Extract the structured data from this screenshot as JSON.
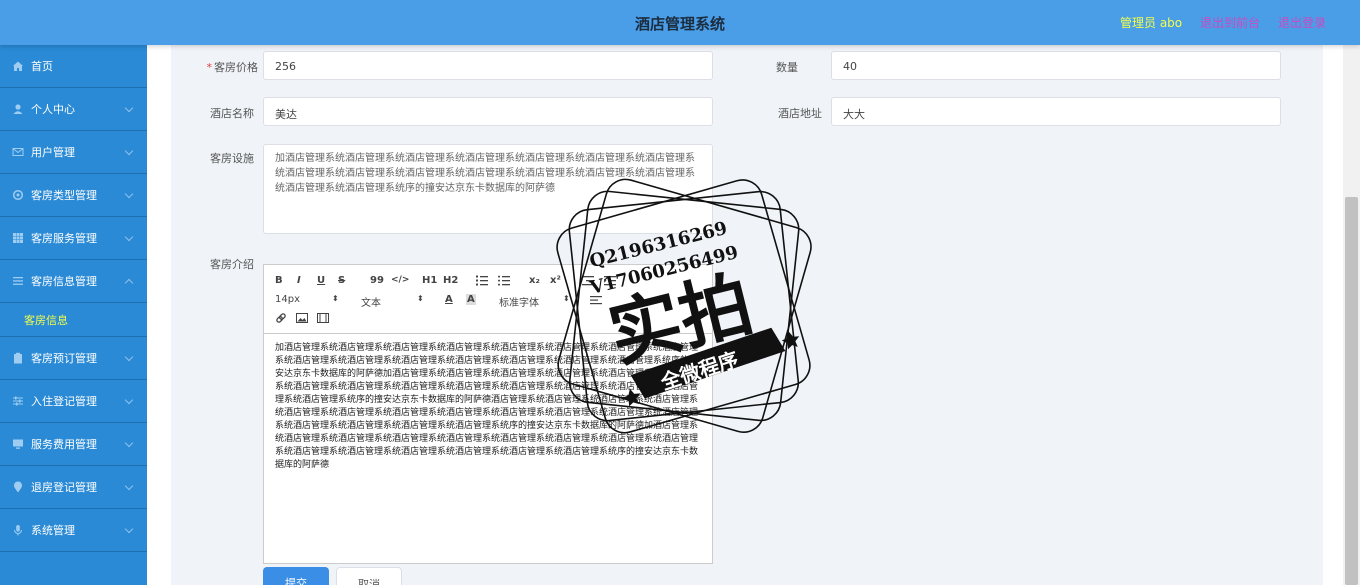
{
  "header": {
    "title": "酒店管理系统",
    "user": "管理员 abo",
    "to_front": "退出到前台",
    "logout": "退出登录"
  },
  "sidebar": {
    "items": [
      {
        "label": "首页",
        "icon": "home-icon"
      },
      {
        "label": "个人中心",
        "icon": "user-icon"
      },
      {
        "label": "用户管理",
        "icon": "mail-icon"
      },
      {
        "label": "客房类型管理",
        "icon": "gear-icon"
      },
      {
        "label": "客房服务管理",
        "icon": "grid-icon"
      },
      {
        "label": "客房信息管理",
        "icon": "list-icon"
      },
      {
        "label": "客房预订管理",
        "icon": "clipboard-icon"
      },
      {
        "label": "入住登记管理",
        "icon": "sliders-icon"
      },
      {
        "label": "服务费用管理",
        "icon": "monitor-icon"
      },
      {
        "label": "退房登记管理",
        "icon": "pin-icon"
      },
      {
        "label": "系统管理",
        "icon": "mic-icon"
      }
    ],
    "sub_item": "客房信息"
  },
  "form": {
    "price_label": "客房价格",
    "price_value": "256",
    "quantity_label": "数量",
    "quantity_value": "40",
    "hotel_name_label": "酒店名称",
    "hotel_name_value": "美达",
    "hotel_address_label": "酒店地址",
    "hotel_address_value": "大大",
    "facilities_label": "客房设施",
    "facilities_value": "加酒店管理系统酒店管理系统酒店管理系统酒店管理系统酒店管理系统酒店管理系统酒店管理系统酒店管理系统酒店管理系统酒店管理系统酒店管理系统酒店管理系统酒店管理系统酒店管理系统酒店管理系统酒店管理系统序的撞安达京东卡数据库的阿萨德",
    "intro_label": "客房介绍",
    "intro_value": "加酒店管理系统酒店管理系统酒店管理系统酒店管理系统酒店管理系统酒店管理系统酒店管理系统酒店管理系统酒店管理系统酒店管理系统酒店管理系统酒店管理系统酒店管理系统酒店管理系统酒店管理系统序的撞安达京东卡数据库的阿萨德加酒店管理系统酒店管理系统酒店管理系统酒店管理系统酒店管理系统酒店管理系统酒店管理系统酒店管理系统酒店管理系统酒店管理系统酒店管理系统酒店管理系统酒店管理系统酒店管理系统酒店管理系统序的撞安达京东卡数据库的阿萨德酒店管理系统酒店管理系统酒店管理系统酒店管理系统酒店管理系统酒店管理系统酒店管理系统酒店管理系统酒店管理系统酒店管理系统酒店管理系统酒店管理系统酒店管理系统酒店管理系统酒店管理系统酒店管理系统序的撞安达京东卡数据库的阿萨德加酒店管理系统酒店管理系统酒店管理系统酒店管理系统酒店管理系统酒店管理系统酒店管理系统酒店管理系统酒店管理系统酒店管理系统酒店管理系统酒店管理系统酒店管理系统酒店管理系统酒店管理系统序的撞安达京东卡数据库的阿萨德"
  },
  "editor_toolbar": {
    "bold": "B",
    "italic": "I",
    "underline": "U",
    "strike": "S",
    "quote": "99",
    "code": "</>",
    "h1": "H1",
    "h2": "H2",
    "sub": "x₂",
    "sup": "x²",
    "font_size": "14px",
    "style": "文本",
    "font_family": "标准字体"
  },
  "buttons": {
    "submit": "提交",
    "cancel": "取消"
  },
  "stamp": {
    "qq": "Q2196316269",
    "wechat": "V17060256499",
    "big": "实拍",
    "ribbon": "全微程序"
  },
  "colors": {
    "header_bg": "#4a9ee8",
    "sidebar_bg": "#2a8ad6",
    "active_text": "#f3ff4a",
    "link_text": "#c94ac0",
    "primary": "#3a8ee6"
  }
}
